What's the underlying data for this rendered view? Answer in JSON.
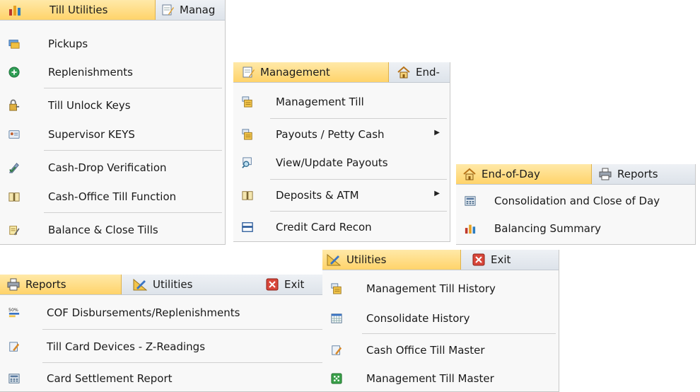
{
  "till_utilities": {
    "tabs": [
      "Till Utilities",
      "Manag"
    ],
    "items": [
      "Pickups",
      "Replenishments",
      "Till Unlock Keys",
      "Supervisor KEYS",
      "Cash-Drop Verification",
      "Cash-Office Till Function",
      "Balance & Close Tills"
    ]
  },
  "management": {
    "tabs": [
      "Management",
      "End-"
    ],
    "items": [
      "Management Till",
      "Payouts / Petty Cash",
      "View/Update Payouts",
      "Deposits & ATM",
      "Credit Card Recon"
    ]
  },
  "end_of_day": {
    "tabs": [
      "End-of-Day",
      "Reports"
    ],
    "items": [
      "Consolidation and Close of Day",
      "Balancing Summary"
    ]
  },
  "reports": {
    "tabs": [
      "Reports",
      "Utilities",
      "Exit"
    ],
    "items": [
      "COF Disbursements/Replenishments",
      "Till Card Devices - Z-Readings",
      "Card Settlement Report"
    ],
    "icon_text": "50%"
  },
  "utilities": {
    "tabs": [
      "Utilities",
      "Exit"
    ],
    "items": [
      "Management Till History",
      "Consolidate History",
      "Cash Office Till Master",
      "Management Till Master"
    ]
  },
  "colors": {
    "active_tab": "#ffd36a",
    "tab_bar": "#dde3ea",
    "menu_bg": "#f8f8f8",
    "separator": "#d0d0d0"
  }
}
